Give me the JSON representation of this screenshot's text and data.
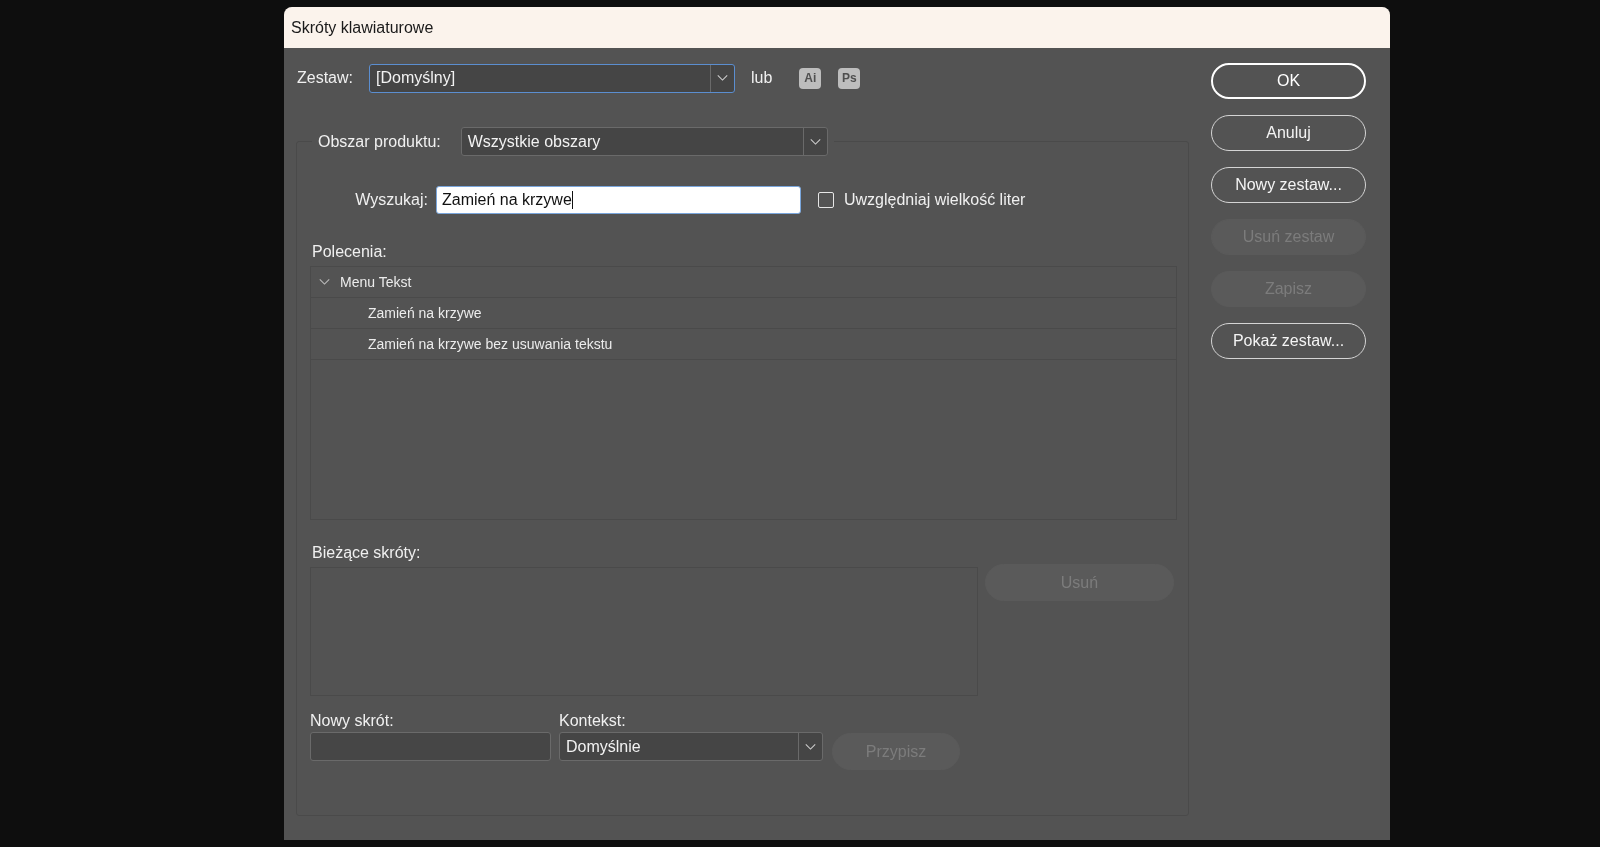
{
  "window": {
    "title": "Skróty klawiaturowe"
  },
  "set": {
    "label": "Zestaw:",
    "value": "[Domyślny]",
    "highlighted": true,
    "separator": "lub",
    "app_buttons": [
      {
        "label": "Ai"
      },
      {
        "label": "Ps"
      }
    ]
  },
  "product_area": {
    "label": "Obszar produktu:",
    "value": "Wszystkie obszary"
  },
  "search": {
    "label": "Wyszukaj:",
    "value": "Zamień na krzywe",
    "focused": true
  },
  "match_case": {
    "label": "Uwzględniaj wielkość liter",
    "checked": false
  },
  "commands": {
    "label": "Polecenia:",
    "tree": [
      {
        "label": "Menu Tekst",
        "expanded": true,
        "children": [
          {
            "label": "Zamień na krzywe"
          },
          {
            "label": "Zamień na krzywe bez usuwania tekstu"
          }
        ]
      }
    ]
  },
  "current_shortcuts": {
    "label": "Bieżące skróty:",
    "remove_button": {
      "label": "Usuń",
      "disabled": true
    }
  },
  "new_shortcut": {
    "label": "Nowy skrót:"
  },
  "context": {
    "label": "Kontekst:",
    "value": "Domyślnie"
  },
  "assign_button": {
    "label": "Przypisz",
    "disabled": true
  },
  "buttons": [
    {
      "label": "OK",
      "default": true,
      "disabled": false
    },
    {
      "label": "Anuluj",
      "default": false,
      "disabled": false
    },
    {
      "label": "Nowy zestaw...",
      "default": false,
      "disabled": false
    },
    {
      "label": "Usuń zestaw",
      "default": false,
      "disabled": true
    },
    {
      "label": "Zapisz",
      "default": false,
      "disabled": true
    },
    {
      "label": "Pokaż zestaw...",
      "default": false,
      "disabled": false
    }
  ]
}
